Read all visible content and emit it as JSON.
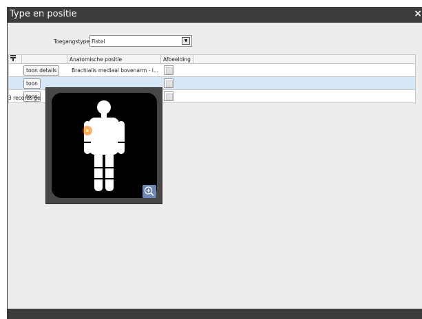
{
  "window": {
    "title": "Type en positie",
    "close_glyph": "×"
  },
  "form": {
    "access_type_label": "Toegangstype",
    "access_type_value": "Fistel"
  },
  "table": {
    "columns": [
      "",
      "",
      "Anatomische positie",
      "Afbeelding"
    ],
    "rows": [
      {
        "button": "toon details",
        "position": "Brachialis mediaal bovenarm - l...",
        "selected": false
      },
      {
        "button": "toon",
        "position": "",
        "selected": true
      },
      {
        "button": "toon",
        "position": "",
        "selected": false
      }
    ],
    "records_text": "3 records ge"
  },
  "popup": {
    "figure": "human-body-icon",
    "marker_color": "#ff8a1a",
    "zoom_icon": "zoom-in-icon"
  },
  "colors": {
    "titlebar": "#3c3c3c",
    "selected_row": "#d6e8f7",
    "window_bg": "#ededed"
  }
}
